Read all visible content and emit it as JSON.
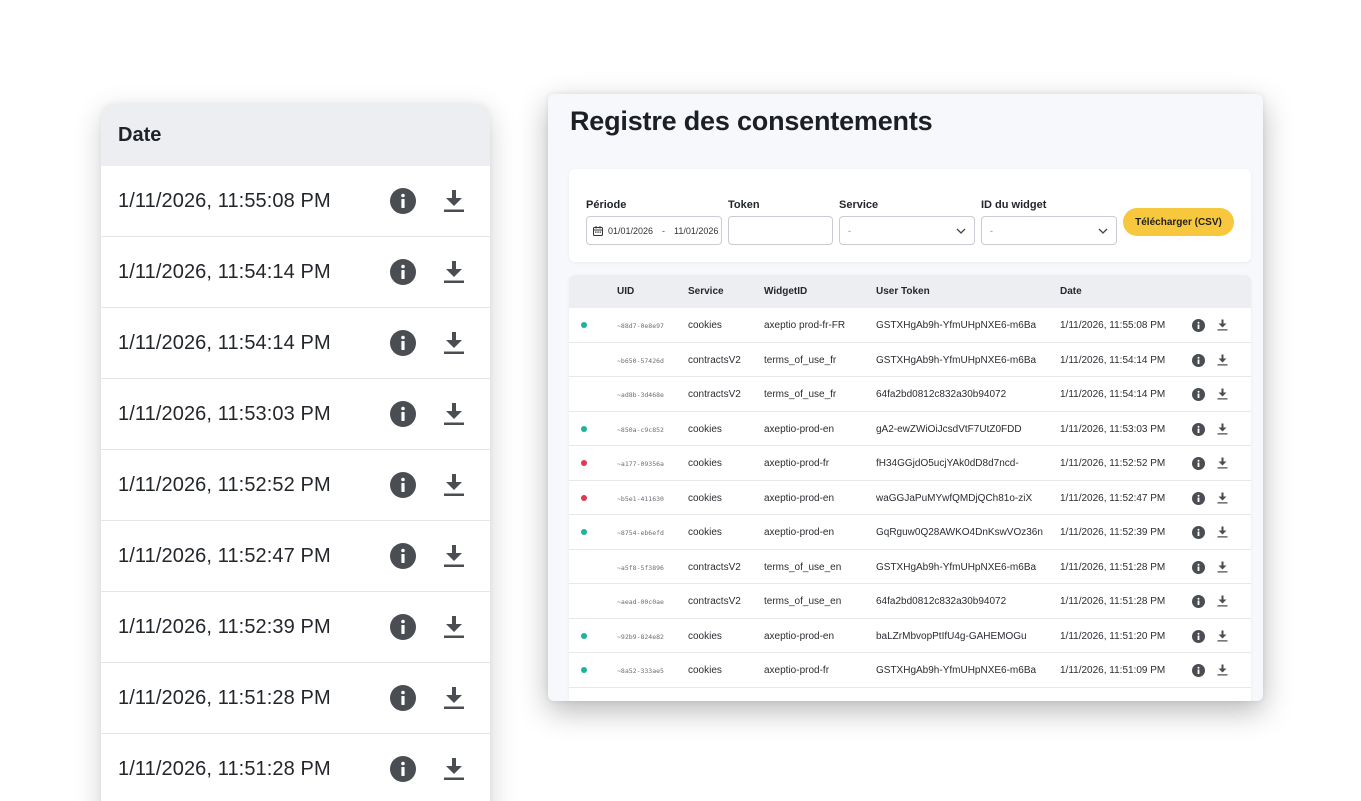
{
  "zoom": {
    "header": "Date",
    "dates": [
      "1/11/2026, 11:55:08 PM",
      "1/11/2026, 11:54:14 PM",
      "1/11/2026, 11:54:14 PM",
      "1/11/2026, 11:53:03 PM",
      "1/11/2026, 11:52:52 PM",
      "1/11/2026, 11:52:47 PM",
      "1/11/2026, 11:52:39 PM",
      "1/11/2026, 11:51:28 PM",
      "1/11/2026, 11:51:28 PM"
    ]
  },
  "page": {
    "title": "Registre des consentements"
  },
  "filters": {
    "period_label": "Période",
    "period_start": "01/01/2026",
    "period_sep": "-",
    "period_end": "11/01/2026",
    "token_label": "Token",
    "token_value": "",
    "service_label": "Service",
    "service_value": "-",
    "widget_label": "ID du widget",
    "widget_value": "-",
    "download_label": "Télécharger (CSV)"
  },
  "table": {
    "headers": {
      "uid": "UID",
      "service": "Service",
      "widget": "WidgetID",
      "token": "User Token",
      "date": "Date"
    },
    "rows": [
      {
        "status": "teal",
        "uid": "~88d7-0e8e97",
        "service": "cookies",
        "widget": "axeptio prod-fr-FR",
        "token": "GSTXHgAb9h-YfmUHpNXE6-m6Ba",
        "date": "1/11/2026, 11:55:08 PM"
      },
      {
        "status": "none",
        "uid": "~b650-57426d",
        "service": "contractsV2",
        "widget": "terms_of_use_fr",
        "token": "GSTXHgAb9h-YfmUHpNXE6-m6Ba",
        "date": "1/11/2026, 11:54:14 PM"
      },
      {
        "status": "none",
        "uid": "~ad8b-3d468e",
        "service": "contractsV2",
        "widget": "terms_of_use_fr",
        "token": "64fa2bd0812c832a30b94072",
        "date": "1/11/2026, 11:54:14 PM"
      },
      {
        "status": "teal",
        "uid": "~850a-c9c852",
        "service": "cookies",
        "widget": "axeptio-prod-en",
        "token": "gA2-ewZWiOiJcsdVtF7UtZ0FDD",
        "date": "1/11/2026, 11:53:03 PM"
      },
      {
        "status": "red",
        "uid": "~a177-09356a",
        "service": "cookies",
        "widget": "axeptio-prod-fr",
        "token": "fH34GGjdO5ucjYAk0dD8d7ncd-",
        "date": "1/11/2026, 11:52:52 PM"
      },
      {
        "status": "red",
        "uid": "~b5e1-411630",
        "service": "cookies",
        "widget": "axeptio-prod-en",
        "token": "waGGJaPuMYwfQMDjQCh81o-ziX",
        "date": "1/11/2026, 11:52:47 PM"
      },
      {
        "status": "teal",
        "uid": "~8754-eb6efd",
        "service": "cookies",
        "widget": "axeptio-prod-en",
        "token": "GqRguw0Q28AWKO4DnKswVOz36n",
        "date": "1/11/2026, 11:52:39 PM"
      },
      {
        "status": "none",
        "uid": "~a5f8-5f3896",
        "service": "contractsV2",
        "widget": "terms_of_use_en",
        "token": "GSTXHgAb9h-YfmUHpNXE6-m6Ba",
        "date": "1/11/2026, 11:51:28 PM"
      },
      {
        "status": "none",
        "uid": "~aead-00c0ae",
        "service": "contractsV2",
        "widget": "terms_of_use_en",
        "token": "64fa2bd0812c832a30b94072",
        "date": "1/11/2026, 11:51:28 PM"
      },
      {
        "status": "teal",
        "uid": "~92b9-824e82",
        "service": "cookies",
        "widget": "axeptio-prod-en",
        "token": "baLZrMbvopPtIfU4g-GAHEMOGu",
        "date": "1/11/2026, 11:51:20 PM"
      },
      {
        "status": "teal",
        "uid": "~8a52-333ae5",
        "service": "cookies",
        "widget": "axeptio-prod-fr",
        "token": "GSTXHgAb9h-YfmUHpNXE6-m6Ba",
        "date": "1/11/2026, 11:51:09 PM"
      }
    ]
  },
  "colors": {
    "teal": "#1bb39a",
    "red": "#e0384f",
    "accent_yellow": "#f7c83e",
    "header_gray": "#eceef2",
    "icon_dark": "#4a4d52"
  },
  "icons": {
    "info": "info-icon",
    "download": "download-icon",
    "calendar": "calendar-icon",
    "chevron": "chevron-down-icon"
  }
}
